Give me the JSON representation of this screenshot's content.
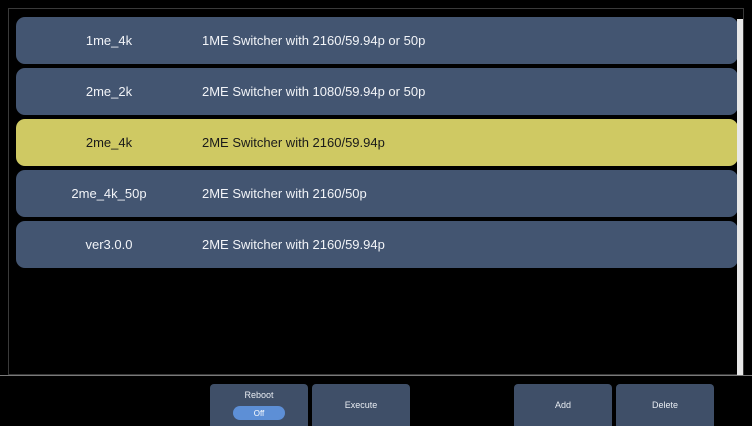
{
  "list": {
    "rows": [
      {
        "name": "1me_4k",
        "description": "1ME Switcher with 2160/59.94p or 50p",
        "selected": false
      },
      {
        "name": "2me_2k",
        "description": "2ME Switcher with 1080/59.94p or 50p",
        "selected": false
      },
      {
        "name": "2me_4k",
        "description": "2ME Switcher with 2160/59.94p",
        "selected": true
      },
      {
        "name": "2me_4k_50p",
        "description": "2ME Switcher with 2160/50p",
        "selected": false
      },
      {
        "name": "ver3.0.0",
        "description": "2ME Switcher with 2160/59.94p",
        "selected": false
      }
    ]
  },
  "toolbar": {
    "reboot_label": "Reboot",
    "reboot_state": "Off",
    "execute_label": "Execute",
    "add_label": "Add",
    "delete_label": "Delete"
  },
  "colors": {
    "row": "#435571",
    "row_selected": "#cfc963",
    "button": "#3f4f68",
    "toggle": "#5d8fd6"
  }
}
